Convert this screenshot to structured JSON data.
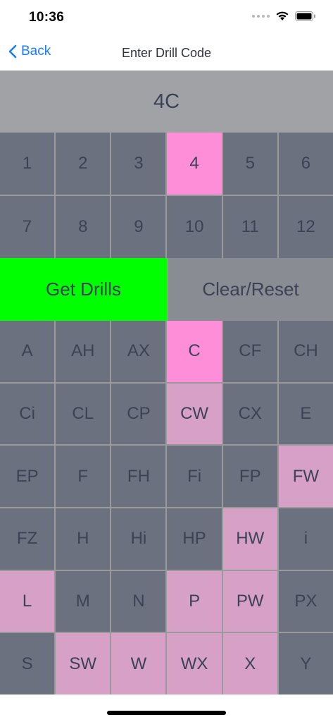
{
  "status_bar": {
    "time": "10:36"
  },
  "nav": {
    "back_label": "Back",
    "title": "Enter Drill Code"
  },
  "code_display": "4C",
  "numbers": [
    {
      "label": "1",
      "state": "normal"
    },
    {
      "label": "2",
      "state": "normal"
    },
    {
      "label": "3",
      "state": "normal"
    },
    {
      "label": "4",
      "state": "selected"
    },
    {
      "label": "5",
      "state": "normal"
    },
    {
      "label": "6",
      "state": "normal"
    },
    {
      "label": "7",
      "state": "normal"
    },
    {
      "label": "8",
      "state": "normal"
    },
    {
      "label": "9",
      "state": "normal"
    },
    {
      "label": "10",
      "state": "normal"
    },
    {
      "label": "11",
      "state": "normal"
    },
    {
      "label": "12",
      "state": "normal"
    }
  ],
  "actions": {
    "get_drills": "Get Drills",
    "clear_reset": "Clear/Reset"
  },
  "codes": [
    {
      "label": "A",
      "state": "normal"
    },
    {
      "label": "AH",
      "state": "normal"
    },
    {
      "label": "AX",
      "state": "normal"
    },
    {
      "label": "C",
      "state": "selected"
    },
    {
      "label": "CF",
      "state": "normal"
    },
    {
      "label": "CH",
      "state": "normal"
    },
    {
      "label": "Ci",
      "state": "normal"
    },
    {
      "label": "CL",
      "state": "normal"
    },
    {
      "label": "CP",
      "state": "normal"
    },
    {
      "label": "CW",
      "state": "highlight"
    },
    {
      "label": "CX",
      "state": "normal"
    },
    {
      "label": "E",
      "state": "normal"
    },
    {
      "label": "EP",
      "state": "normal"
    },
    {
      "label": "F",
      "state": "normal"
    },
    {
      "label": "FH",
      "state": "normal"
    },
    {
      "label": "Fi",
      "state": "normal"
    },
    {
      "label": "FP",
      "state": "normal"
    },
    {
      "label": "FW",
      "state": "highlight"
    },
    {
      "label": "FZ",
      "state": "normal"
    },
    {
      "label": "H",
      "state": "normal"
    },
    {
      "label": "Hi",
      "state": "normal"
    },
    {
      "label": "HP",
      "state": "normal"
    },
    {
      "label": "HW",
      "state": "highlight"
    },
    {
      "label": "i",
      "state": "normal"
    },
    {
      "label": "L",
      "state": "highlight"
    },
    {
      "label": "M",
      "state": "normal"
    },
    {
      "label": "N",
      "state": "normal"
    },
    {
      "label": "P",
      "state": "highlight"
    },
    {
      "label": "PW",
      "state": "highlight"
    },
    {
      "label": "PX",
      "state": "normal"
    },
    {
      "label": "S",
      "state": "normal"
    },
    {
      "label": "SW",
      "state": "highlight"
    },
    {
      "label": "W",
      "state": "highlight"
    },
    {
      "label": "WX",
      "state": "highlight"
    },
    {
      "label": "X",
      "state": "highlight"
    },
    {
      "label": "Y",
      "state": "normal"
    }
  ],
  "colors": {
    "accent": "#1e7cf2",
    "get_drills_bg": "#00ff00",
    "cell_bg": "#6b717e",
    "selected_bg": "#ff8ed9",
    "highlight_bg": "#d6a0c7",
    "display_bg": "#a0a2a5"
  }
}
